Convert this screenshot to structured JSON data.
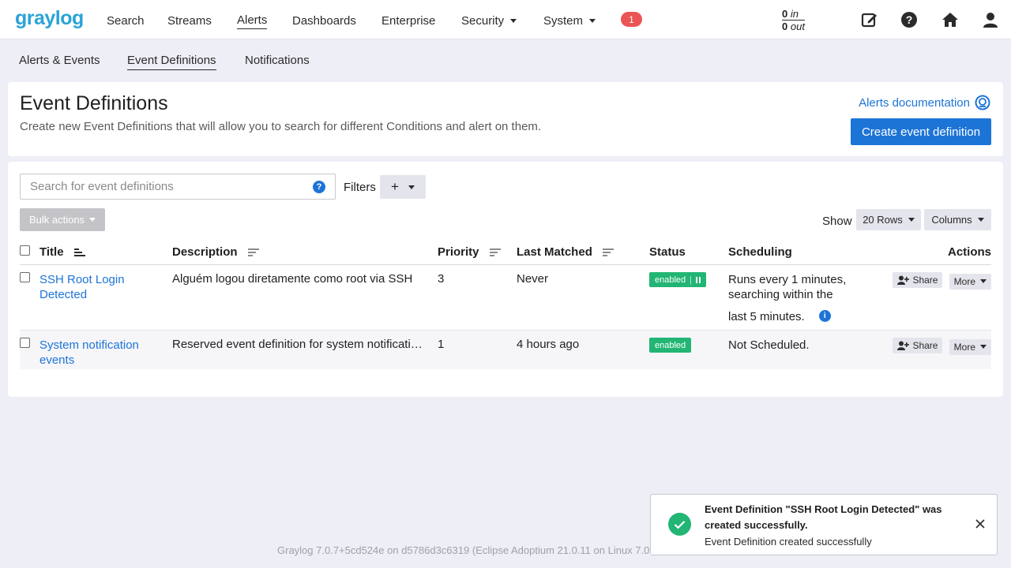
{
  "nav": {
    "logo": "graylog",
    "items": [
      "Search",
      "Streams",
      "Alerts",
      "Dashboards",
      "Enterprise"
    ],
    "security": "Security",
    "system": "System",
    "notification_count": "1",
    "throughput_in_value": "0",
    "throughput_in_label": "in",
    "throughput_out_value": "0",
    "throughput_out_label": "out"
  },
  "subnav": {
    "alerts_events": "Alerts & Events",
    "event_definitions": "Event Definitions",
    "notifications": "Notifications"
  },
  "header": {
    "title": "Event Definitions",
    "description": "Create new Event Definitions that will allow you to search for different Conditions and alert on them.",
    "docs_link": "Alerts documentation",
    "create_button": "Create event definition"
  },
  "toolbar": {
    "search_placeholder": "Search for event definitions",
    "filters_label": "Filters",
    "bulk_actions": "Bulk actions",
    "show_label": "Show",
    "rows": "20 Rows",
    "columns": "Columns"
  },
  "table": {
    "headers": {
      "title": "Title",
      "description": "Description",
      "priority": "Priority",
      "last_matched": "Last Matched",
      "status": "Status",
      "scheduling": "Scheduling",
      "actions": "Actions"
    },
    "rows": [
      {
        "title_line1": "SSH Root Login",
        "title_line2": "Detected",
        "description": "Alguém logou diretamente como root via SSH",
        "priority": "3",
        "last_matched": "Never",
        "status": "enabled",
        "sched_line1": "Runs every 1 minutes,",
        "sched_line2": "searching within the",
        "sched_line3": "last 5 minutes.",
        "share": "Share",
        "more": "More"
      },
      {
        "title_line1": "System notification",
        "title_line2": "events",
        "description": "Reserved event definition for system notificati…",
        "priority": "1",
        "last_matched": "4 hours ago",
        "status": "enabled",
        "sched_line1": "Not Scheduled.",
        "share": "Share",
        "more": "More"
      }
    ]
  },
  "footer": "Graylog 7.0.7+5cd524e on d5786d3c6319 (Eclipse Adoptium 21.0.11 on Linux 7.0.5",
  "toast": {
    "title": "Event Definition \"SSH Root Login Detected\" was created successfully.",
    "message": "Event Definition created successfully"
  },
  "colors": {
    "accent": "#1d74d7",
    "success": "#22b573",
    "danger": "#eb5454",
    "logo": "#2aa3d8"
  }
}
